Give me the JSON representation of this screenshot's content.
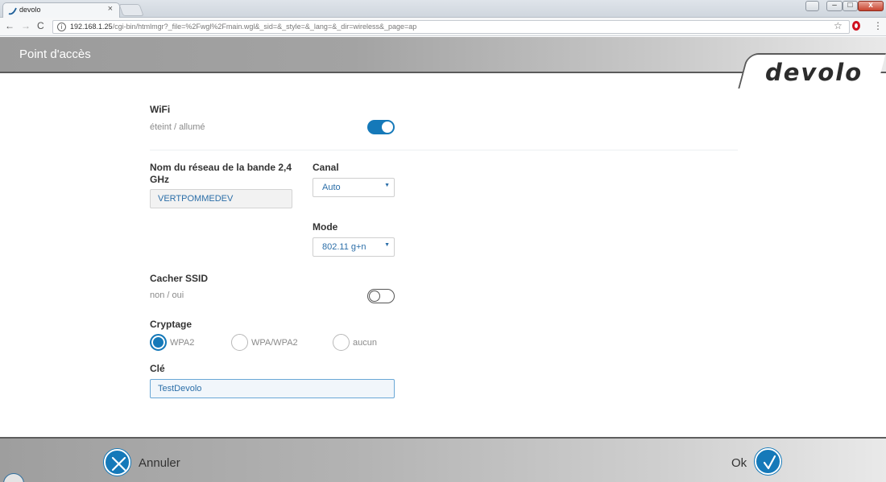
{
  "browser": {
    "tab_title": "devolo",
    "tab_close": "×",
    "url_host": "192.168.1.25",
    "url_path": "/cgi-bin/htmlmgr?_file=%2Fwgl%2Fmain.wgl&_sid=&_style=&_lang=&_dir=wireless&_page=ap",
    "info_icon": "i",
    "nav": {
      "back": "←",
      "forward": "→",
      "reload": "C"
    },
    "star": "☆",
    "menu": "⋮",
    "window_close": "x"
  },
  "header": {
    "title": "Point d'accès",
    "logo": "devolo"
  },
  "wifi": {
    "label": "WiFi",
    "sublabel": "éteint / allumé",
    "enabled": true
  },
  "network": {
    "label": "Nom du réseau de la bande 2,4 GHz",
    "value": "VERTPOMMEDEV"
  },
  "channel": {
    "label": "Canal",
    "selected": "Auto"
  },
  "mode": {
    "label": "Mode",
    "selected": "802.11 g+n"
  },
  "hide_ssid": {
    "label": "Cacher SSID",
    "sublabel": "non / oui",
    "enabled": false
  },
  "encryption": {
    "label": "Cryptage",
    "options": [
      {
        "label": "WPA2",
        "checked": true
      },
      {
        "label": "WPA/WPA2",
        "checked": false
      },
      {
        "label": "aucun",
        "checked": false
      }
    ]
  },
  "key": {
    "label": "Clé",
    "value": "TestDevolo"
  },
  "footer": {
    "cancel_label": "Annuler",
    "ok_label": "Ok"
  },
  "colors": {
    "accent": "#1579b9",
    "header_gray": "#9b9b9b",
    "divider": "#5a5a5a"
  },
  "icons": [
    "devolo-tab-icon",
    "info-icon",
    "star-icon",
    "opera-icon",
    "cancel-x-icon",
    "ok-check-icon"
  ]
}
